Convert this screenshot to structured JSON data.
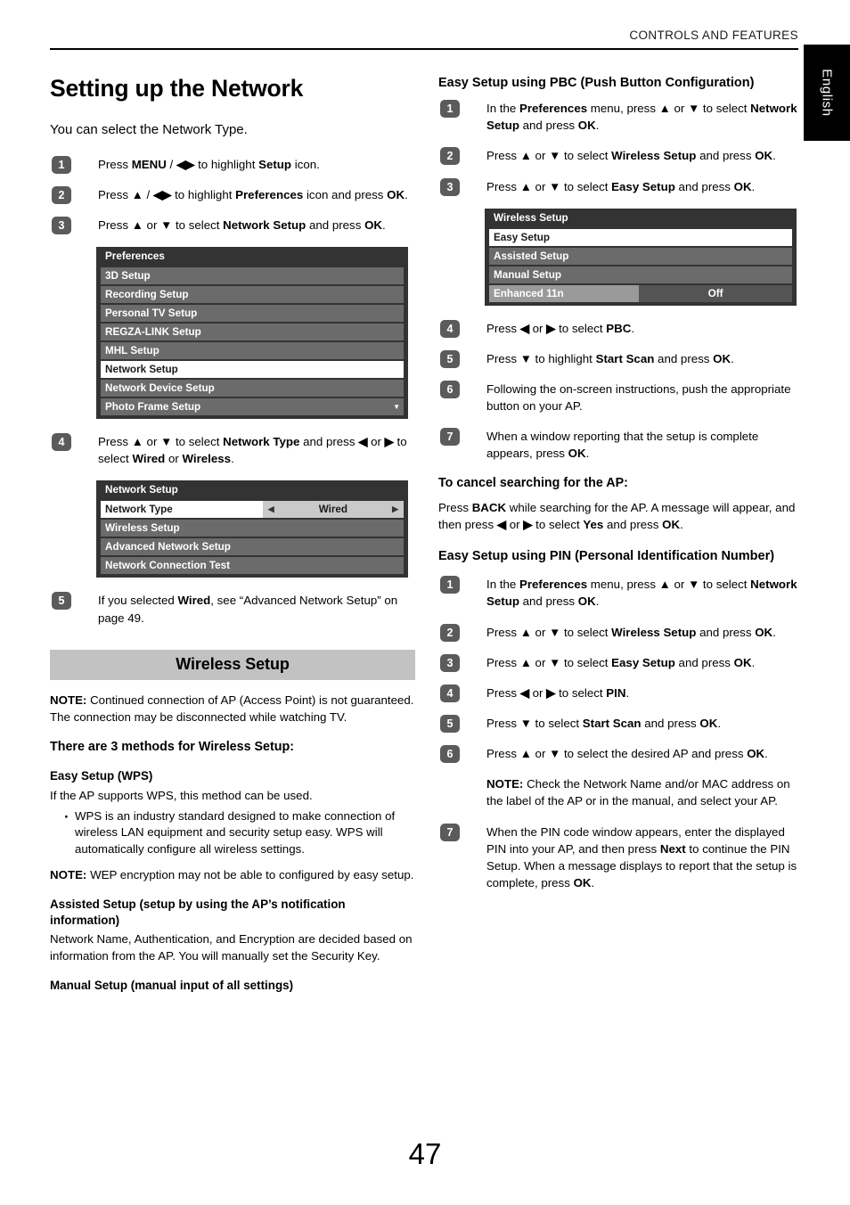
{
  "header": {
    "running_head": "CONTROLS AND FEATURES",
    "language_tab": "English"
  },
  "page_number": "47",
  "left_column": {
    "title": "Setting up the Network",
    "lead": "You can select the Network Type.",
    "steps_top": [
      {
        "num": "1",
        "html": "Press <b>MENU</b> / <b>◀▶</b> to highlight <b>Setup</b> icon."
      },
      {
        "num": "2",
        "html": "Press <b>▲</b> / <b>◀▶</b> to highlight <b>Preferences</b> icon and press <b>OK</b>."
      },
      {
        "num": "3",
        "html": "Press <b>▲</b> or <b>▼</b> to select <b>Network Setup</b> and press <b>OK</b>."
      }
    ],
    "preferences_menu": {
      "title": "Preferences",
      "rows": [
        {
          "label": "3D Setup",
          "selected": false
        },
        {
          "label": "Recording Setup",
          "selected": false
        },
        {
          "label": "Personal TV Setup",
          "selected": false
        },
        {
          "label": "REGZA-LINK Setup",
          "selected": false
        },
        {
          "label": "MHL Setup",
          "selected": false
        },
        {
          "label": "Network Setup",
          "selected": true
        },
        {
          "label": "Network Device Setup",
          "selected": false
        },
        {
          "label": "Photo Frame Setup",
          "selected": false,
          "more_caret": "▼"
        }
      ]
    },
    "step4": {
      "num": "4",
      "html": "Press <b>▲</b> or <b>▼</b> to select <b>Network Type</b> and press <b>◀</b> or <b>▶</b> to select <b>Wired</b> or <b>Wireless</b>."
    },
    "network_setup_menu": {
      "title": "Network Setup",
      "network_type_label": "Network Type",
      "network_type_value": "Wired",
      "left_arrow": "◀",
      "right_arrow": "▶",
      "rows": [
        {
          "label": "Wireless Setup"
        },
        {
          "label": "Advanced Network Setup"
        },
        {
          "label": "Network Connection Test"
        }
      ]
    },
    "step5": {
      "num": "5",
      "html": "If you selected <b>Wired</b>, see “Advanced Network Setup” on page 49."
    },
    "band_heading": "Wireless Setup",
    "note1_html": "<b>NOTE:</b> Continued connection of AP (Access Point) is not guaranteed. The connection may be disconnected while watching TV.",
    "methods_heading": "There are 3 methods for Wireless Setup:",
    "easy_setup_heading": "Easy Setup (WPS)",
    "easy_setup_body": "If the AP supports WPS, this method can be used.",
    "easy_setup_bullet": "WPS is an industry standard designed to make connection of wireless LAN equipment and security setup easy. WPS will automatically configure all wireless settings.",
    "note2_html": "<b>NOTE:</b> WEP encryption may not be able to configured by easy setup.",
    "assisted_heading": "Assisted Setup (setup by using the AP’s notification information)",
    "assisted_body": "Network Name, Authentication, and Encryption are decided based on information from the AP. You will manually set the Security Key.",
    "manual_heading": "Manual Setup (manual input of all settings)"
  },
  "right_column": {
    "pbc_heading": "Easy Setup using PBC (Push Button Configuration)",
    "pbc_steps_top": [
      {
        "num": "1",
        "html": "In the <b>Preferences</b> menu, press <b>▲</b> or <b>▼</b> to select <b>Network Setup</b> and press <b>OK</b>."
      },
      {
        "num": "2",
        "html": "Press <b>▲</b> or <b>▼</b> to select <b>Wireless Setup</b> and press <b>OK</b>."
      },
      {
        "num": "3",
        "html": "Press <b>▲</b> or <b>▼</b> to select <b>Easy Setup</b> and press <b>OK</b>."
      }
    ],
    "wireless_setup_menu": {
      "title": "Wireless Setup",
      "rows": [
        {
          "label": "Easy Setup",
          "selected": true
        },
        {
          "label": "Assisted Setup",
          "selected": false
        },
        {
          "label": "Manual Setup",
          "selected": false
        }
      ],
      "value_row": {
        "label": "Enhanced 11n",
        "value": "Off"
      }
    },
    "pbc_steps_bottom": [
      {
        "num": "4",
        "html": "Press <b>◀</b> or <b>▶</b> to select <b>PBC</b>."
      },
      {
        "num": "5",
        "html": "Press <b>▼</b> to highlight <b>Start Scan</b> and press <b>OK</b>."
      },
      {
        "num": "6",
        "html": "Following the on-screen instructions, push the appropriate button on your AP."
      },
      {
        "num": "7",
        "html": "When a window reporting that the setup is complete appears, press <b>OK</b>."
      }
    ],
    "cancel_heading": "To cancel searching for the AP:",
    "cancel_body_html": "Press <b>BACK</b> while searching for the AP. A message will appear, and then press <b>◀</b> or <b>▶</b> to select <b>Yes</b> and press <b>OK</b>.",
    "pin_heading": "Easy Setup using PIN (Personal Identification Number)",
    "pin_steps": [
      {
        "num": "1",
        "html": "In the <b>Preferences</b> menu, press <b>▲</b> or <b>▼</b> to select <b>Network Setup</b> and press <b>OK</b>."
      },
      {
        "num": "2",
        "html": "Press <b>▲</b> or <b>▼</b> to select <b>Wireless Setup</b> and press <b>OK</b>."
      },
      {
        "num": "3",
        "html": "Press <b>▲</b> or <b>▼</b> to select <b>Easy Setup</b> and press <b>OK</b>."
      },
      {
        "num": "4",
        "html": "Press <b>◀</b> or <b>▶</b> to select <b>PIN</b>."
      },
      {
        "num": "5",
        "html": "Press <b>▼</b> to select <b>Start Scan</b> and press <b>OK</b>."
      },
      {
        "num": "6",
        "html": "Press <b>▲</b> or <b>▼</b> to select the desired AP and press <b>OK</b>."
      }
    ],
    "pin_note_html": "<b>NOTE:</b> Check the Network Name and/or MAC address on the label of the AP or in the manual, and select your AP.",
    "pin_step7": {
      "num": "7",
      "html": "When the PIN code window appears, enter the displayed PIN into your AP, and then press <b>Next</b> to continue the PIN Setup. When a message displays to report that the setup is complete, press <b>OK</b>."
    }
  }
}
